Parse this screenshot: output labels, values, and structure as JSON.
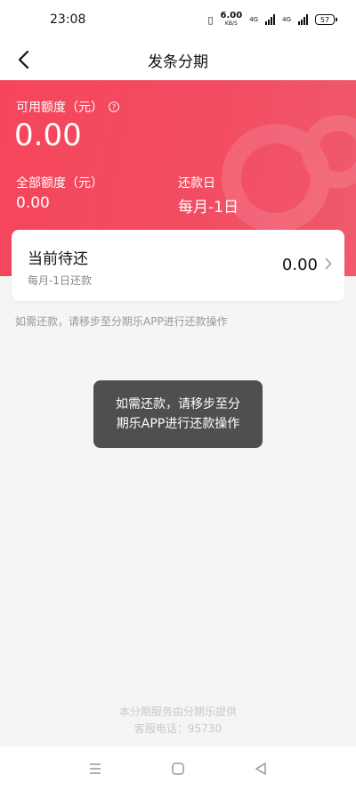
{
  "status_bar": {
    "time": "23:08",
    "net_speed": "6.00",
    "net_unit": "KB/S",
    "net_type_1": "4G",
    "net_type_2": "4G",
    "battery": "57"
  },
  "nav": {
    "title": "发条分期",
    "back_icon": "chevron-left-icon"
  },
  "credit": {
    "available_label": "可用额度（元）",
    "available_value": "0.00",
    "total_label": "全部额度（元）",
    "total_value": "0.00",
    "due_label": "还款日",
    "due_value": "每月-1日"
  },
  "pending": {
    "title": "当前待还",
    "subtitle": "每月-1日还款",
    "amount": "0.00"
  },
  "note": "如需还款，请移步至分期乐APP进行还款操作",
  "toast": "如需还款，请移步至分期乐APP进行还款操作",
  "footer": {
    "line1": "本分期服务由分期乐提供",
    "line2": "客服电话：95730"
  },
  "colors": {
    "brand": "#f5455c",
    "toast_bg": "#464646"
  }
}
